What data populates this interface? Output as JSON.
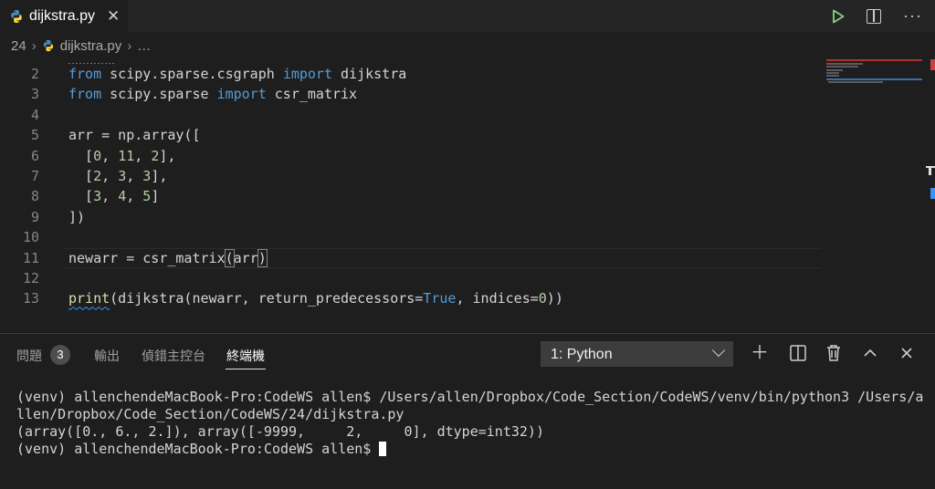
{
  "tab": {
    "filename": "dijkstra.py",
    "close_icon": "close-icon"
  },
  "breadcrumb": {
    "folder": "24",
    "file": "dijkstra.py",
    "ellipsis": "…"
  },
  "editor": {
    "lines": [
      {
        "num": "2",
        "tokens": [
          [
            "kw",
            "from"
          ],
          [
            "",
            " scipy.sparse.csgraph "
          ],
          [
            "kw",
            "import"
          ],
          [
            "",
            " dijkstra"
          ]
        ]
      },
      {
        "num": "3",
        "tokens": [
          [
            "kw",
            "from"
          ],
          [
            "",
            " scipy.sparse "
          ],
          [
            "kw",
            "import"
          ],
          [
            "",
            " csr_matrix"
          ]
        ]
      },
      {
        "num": "4",
        "tokens": []
      },
      {
        "num": "5",
        "tokens": [
          [
            "",
            "arr = np.array(["
          ]
        ]
      },
      {
        "num": "6",
        "tokens": [
          [
            "",
            "  ["
          ],
          [
            "num",
            "0"
          ],
          [
            "",
            ", "
          ],
          [
            "num",
            "11"
          ],
          [
            "",
            ", "
          ],
          [
            "num",
            "2"
          ],
          [
            "",
            "],"
          ]
        ]
      },
      {
        "num": "7",
        "tokens": [
          [
            "",
            "  ["
          ],
          [
            "num",
            "2"
          ],
          [
            "",
            ", "
          ],
          [
            "num",
            "3"
          ],
          [
            "",
            ", "
          ],
          [
            "num",
            "3"
          ],
          [
            "",
            "],"
          ]
        ]
      },
      {
        "num": "8",
        "tokens": [
          [
            "",
            "  ["
          ],
          [
            "num",
            "3"
          ],
          [
            "",
            ", "
          ],
          [
            "num",
            "4"
          ],
          [
            "",
            ", "
          ],
          [
            "num",
            "5"
          ],
          [
            "",
            "]"
          ]
        ]
      },
      {
        "num": "9",
        "tokens": [
          [
            "",
            "])"
          ]
        ]
      },
      {
        "num": "10",
        "tokens": []
      },
      {
        "num": "11",
        "tokens": [
          [
            "",
            "newarr = csr_matrix"
          ],
          [
            "bm",
            "("
          ],
          [
            "",
            "arr"
          ],
          [
            "bm",
            ")"
          ]
        ]
      },
      {
        "num": "12",
        "tokens": []
      },
      {
        "num": "13",
        "tokens": [
          [
            "fnsq",
            "print"
          ],
          [
            "",
            "(dijkstra(newarr, return_predecessors="
          ],
          [
            "kw",
            "True"
          ],
          [
            "",
            ", indices="
          ],
          [
            "num",
            "0"
          ],
          [
            "",
            "))"
          ]
        ]
      }
    ]
  },
  "panel": {
    "tabs": {
      "problems": "問題",
      "problems_count": "3",
      "output": "輸出",
      "debug_console": "偵錯主控台",
      "terminal": "終端機"
    },
    "terminal_select": "1: Python",
    "icons": [
      "add-icon",
      "split-icon",
      "trash-icon",
      "chevron-up-icon",
      "close-icon"
    ]
  },
  "terminal": {
    "line1": "(venv) allenchendeMacBook-Pro:CodeWS allen$ /Users/allen/Dropbox/Code_Section/CodeWS/venv/bin/python3 /Users/a",
    "line2": "llen/Dropbox/Code_Section/CodeWS/24/dijkstra.py",
    "line3": "(array([0., 6., 2.]), array([-9999,     2,     0], dtype=int32))",
    "line4": "(venv) allenchendeMacBook-Pro:CodeWS allen$ "
  }
}
